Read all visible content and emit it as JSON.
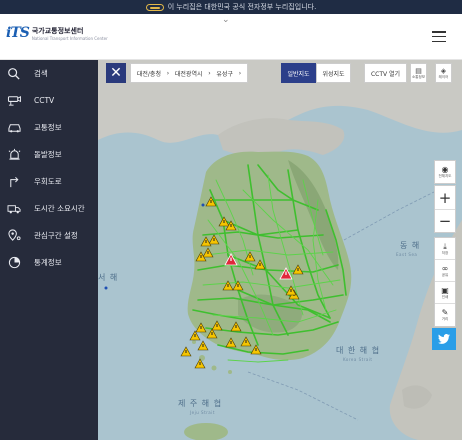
{
  "gov_banner": {
    "text": "이 누리집은 대한민국 공식 전자정부 누리집입니다."
  },
  "header": {
    "logo_mark": "iTS",
    "logo_title": "국가교통정보센터",
    "logo_subtitle": "National Transport Information Center"
  },
  "sidebar": {
    "items": [
      {
        "label": "검색",
        "icon": "search-icon"
      },
      {
        "label": "CCTV",
        "icon": "cctv-icon"
      },
      {
        "label": "교통정보",
        "icon": "car-icon"
      },
      {
        "label": "돌발정보",
        "icon": "siren-icon"
      },
      {
        "label": "우회도로",
        "icon": "detour-icon"
      },
      {
        "label": "도시간 소요시간",
        "icon": "truck-clock-icon"
      },
      {
        "label": "관심구간 설정",
        "icon": "map-pin-icon"
      },
      {
        "label": "통계정보",
        "icon": "chart-icon"
      }
    ]
  },
  "map_toolbar": {
    "breadcrumb": [
      "대전/충청",
      "대전광역시",
      "유성구"
    ],
    "map_type_normal": "일반지도",
    "map_type_satellite": "위성지도",
    "cctv_open": "CCTV 열기",
    "legend_label": "소통정보",
    "layer_label": "레이어"
  },
  "right_tools": {
    "full_view": "전체지도",
    "zoom_in": "+",
    "zoom_out": "−",
    "save": "저장",
    "share": "공유",
    "print": "인쇄",
    "measure": "거리"
  },
  "map_labels": {
    "east_sea": "동 해",
    "east_sea_en": "East Sea",
    "yellow_sea": "서 해",
    "korea_strait": "대 한 해 협",
    "korea_strait_en": "Korea Strait",
    "jeju_strait": "제 주 해 협",
    "jeju_strait_en": "Jeju Strait"
  },
  "colors": {
    "sidebar_bg": "#262b3b",
    "accent_blue": "#2c3f8a",
    "road_green": "#3fbf2f",
    "incident_yellow": "#f5c400",
    "incident_red": "#e0283c",
    "twitter": "#2a9ee8"
  }
}
